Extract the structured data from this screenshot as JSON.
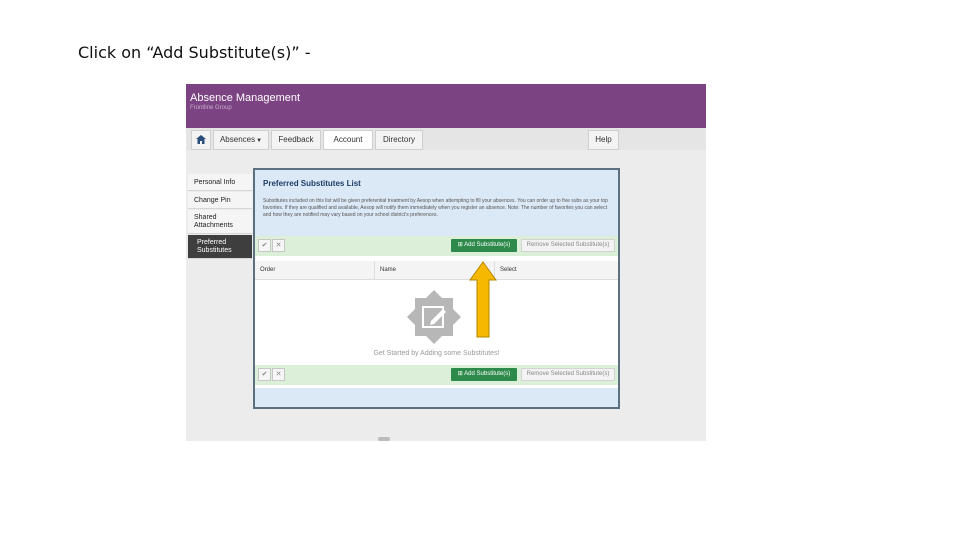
{
  "slide": {
    "instruction": "Click on “Add Substitute(s)” -"
  },
  "app": {
    "title": "Absence Management",
    "subtitle": "Frontline Group"
  },
  "nav": {
    "home_icon": "home-icon",
    "absences": "Absences",
    "feedback": "Feedback",
    "account": "Account",
    "directory": "Directory",
    "help": "Help"
  },
  "sidebar": {
    "items": [
      {
        "label": "Personal Info"
      },
      {
        "label": "Change Pin"
      },
      {
        "label": "Shared Attachments"
      },
      {
        "label": "Preferred Substitutes"
      }
    ]
  },
  "panel": {
    "title": "Preferred Substitutes List",
    "description": "Substitutes included on this list will be given preferential treatment by Aesop when attempting to fill your absences. You can order up to five subs as your top favorites. If they are qualified and available, Aesop will notify them immediately when you register an absence. Note: The number of favorites you can select and how they are notified may vary based on your school district's preferences."
  },
  "toolbar": {
    "add_label": "Add Substitute(s)",
    "remove_label": "Remove Selected Substitute(s)"
  },
  "table": {
    "columns": [
      "Order",
      "Name",
      "Select"
    ],
    "empty_message": "Get Started by Adding some Substitutes!"
  },
  "colors": {
    "header": "#7b4382",
    "add_button": "#2e8a4a",
    "arrow": "#f6b800"
  }
}
